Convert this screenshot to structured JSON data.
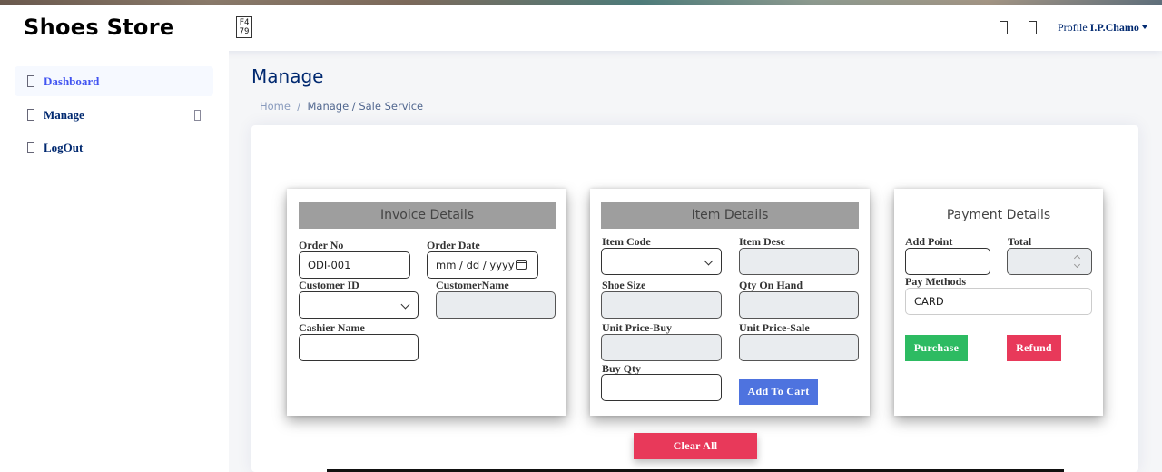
{
  "header": {
    "brand": "Shoes Store",
    "toggle_glyph": "F4\n79",
    "profile_label": "Profile",
    "profile_name": "I.P.Chamo"
  },
  "sidebar": {
    "items": [
      {
        "label": "Dashboard",
        "icon": "grid-icon",
        "active": true
      },
      {
        "label": "Manage",
        "icon": "menu-icon",
        "active": false
      },
      {
        "label": "LogOut",
        "icon": "logout-icon",
        "active": false
      }
    ]
  },
  "page": {
    "title": "Manage",
    "breadcrumb": {
      "home": "Home",
      "sep": "/",
      "current": "Manage / Sale Service"
    }
  },
  "invoice": {
    "title": "Invoice Details",
    "order_no_label": "Order No",
    "order_no_value": "ODI-001",
    "order_date_label": "Order Date",
    "order_date_placeholder": "mm / dd / yyyy",
    "customer_id_label": "Customer ID",
    "customer_name_label": "CustomerName",
    "cashier_name_label": "Cashier Name"
  },
  "item": {
    "title": "Item Details",
    "item_code_label": "Item Code",
    "item_desc_label": "Item Desc",
    "shoe_size_label": "Shoe Size",
    "qty_on_hand_label": "Qty On Hand",
    "unit_buy_label": "Unit Price-Buy",
    "unit_sale_label": "Unit Price-Sale",
    "buy_qty_label": "Buy Qty",
    "add_to_cart": "Add To Cart"
  },
  "payment": {
    "title": "Payment Details",
    "add_point_label": "Add Point",
    "total_label": "Total",
    "pay_methods_label": "Pay Methods",
    "pay_method_value": "CARD",
    "purchase": "Purchase",
    "refund": "Refund"
  },
  "clear_all": "Clear All",
  "colors": {
    "brand_navy": "#012970",
    "accent_blue": "#4e73df",
    "success_green": "#2dbb62",
    "danger_red": "#e8395a",
    "panel_header_gray": "#9e9e9e"
  }
}
